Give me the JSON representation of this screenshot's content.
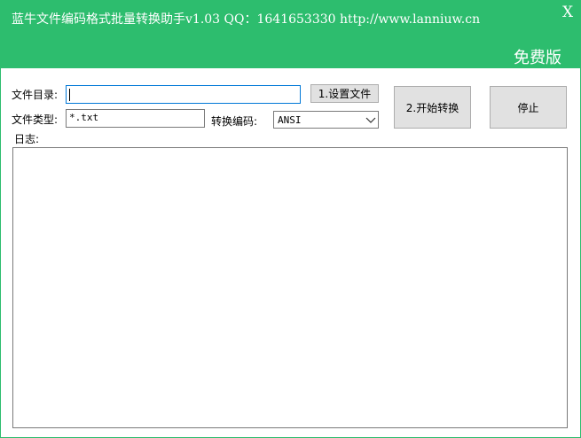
{
  "window": {
    "title": "蓝牛文件编码格式批量转换助手v1.03  QQ：1641653330  http://www.lanniuw.cn",
    "close_label": "X",
    "edition": "免费版"
  },
  "form": {
    "dir_label": "文件目录:",
    "dir_value": "",
    "set_button": "1.设置文件",
    "start_button": "2.开始转换",
    "stop_button": "停止",
    "type_label": "文件类型:",
    "type_value": "*.txt",
    "encoding_label": "转换编码:",
    "encoding_value": "ANSI",
    "log_label": "日志:"
  },
  "colors": {
    "header": "#2dbd6e",
    "button": "#e1e1e1",
    "focus_border": "#0078d7"
  }
}
